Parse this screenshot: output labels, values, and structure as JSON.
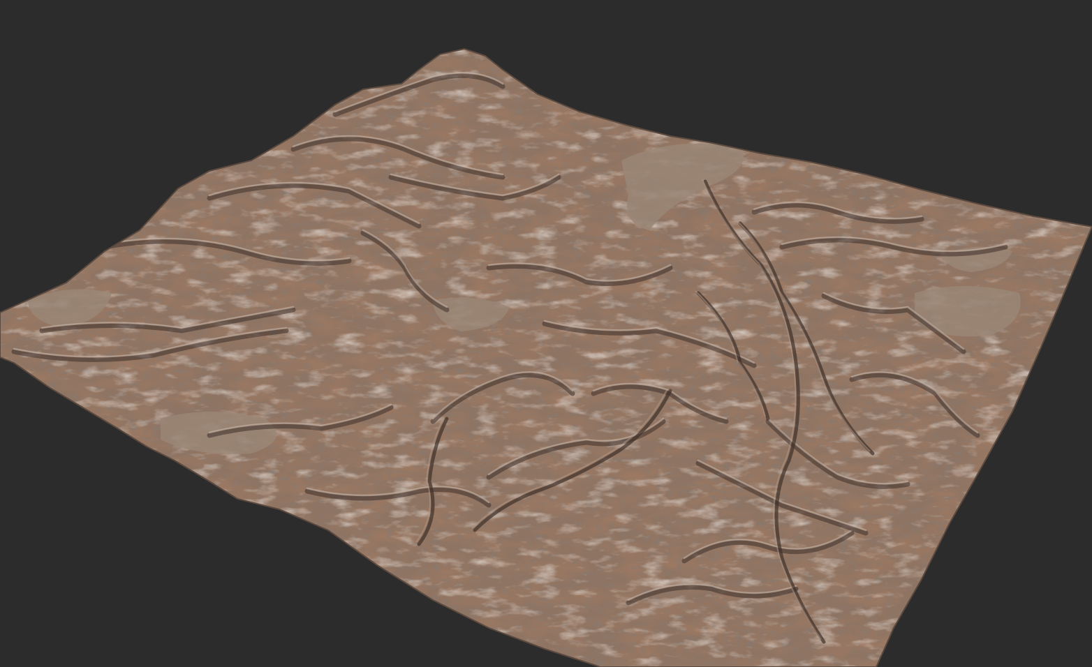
{
  "viewport": {
    "background_color": "#2c2c2c"
  },
  "terrain": {
    "description_label": "",
    "colors": {
      "base": "#8e7463",
      "light": "#b39a88",
      "highlight": "#c8b5a8",
      "sand_flat": "#9a8676",
      "shadow": "#3e3029",
      "mid_shadow": "#5c4a3f",
      "rock_warm": "#a07a62"
    }
  }
}
